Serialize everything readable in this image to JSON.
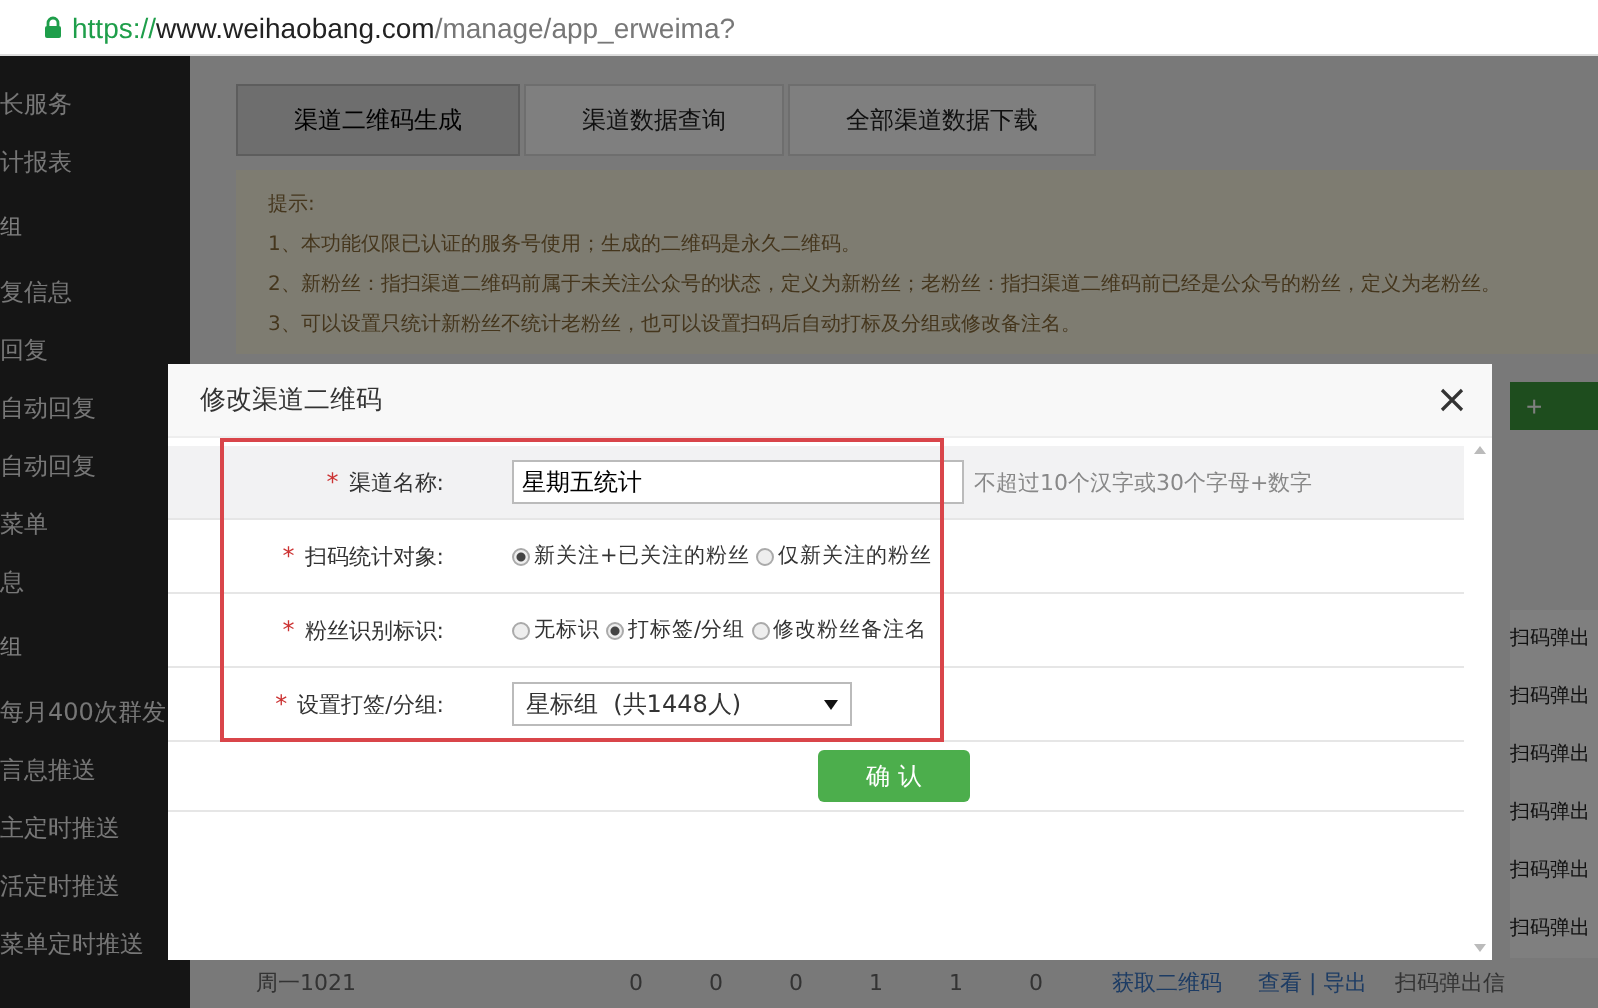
{
  "address_bar": {
    "scheme": "https://",
    "host": "www.weihaobang.com",
    "path": "/manage/app_erweima?"
  },
  "sidebar": {
    "items": [
      {
        "kind": "item",
        "label": "长服务"
      },
      {
        "kind": "item",
        "label": "计报表"
      },
      {
        "kind": "header",
        "label": "组"
      },
      {
        "kind": "item",
        "label": "复信息"
      },
      {
        "kind": "item",
        "label": "回复"
      },
      {
        "kind": "item",
        "label": "自动回复"
      },
      {
        "kind": "item",
        "label": "自动回复"
      },
      {
        "kind": "item",
        "label": "菜单"
      },
      {
        "kind": "item",
        "label": "息"
      },
      {
        "kind": "header",
        "label": "组"
      },
      {
        "kind": "item",
        "label": "每月400次群发"
      },
      {
        "kind": "item",
        "label": "言息推送"
      },
      {
        "kind": "item",
        "label": "主定时推送"
      },
      {
        "kind": "item",
        "label": "活定时推送"
      },
      {
        "kind": "item",
        "label": "菜单定时推送"
      }
    ]
  },
  "tabs": [
    {
      "label": "渠道二维码生成",
      "selected": true
    },
    {
      "label": "渠道数据查询",
      "selected": false
    },
    {
      "label": "全部渠道数据下载",
      "selected": false
    }
  ],
  "notice": {
    "title": "提示:",
    "lines": [
      "1、本功能仅限已认证的服务号使用；生成的二维码是永久二维码。",
      "2、新粉丝：指扫渠道二维码前属于未关注公众号的状态，定义为新粉丝；老粉丝：指扫渠道二维码前已经是公众号的粉丝，定义为老粉丝。",
      "3、可以设置只统计新粉丝不统计老粉丝，也可以设置扫码后自动打标及分组或修改备注名。"
    ]
  },
  "create_button": {
    "label": "+"
  },
  "side_column": {
    "cells": [
      "扫码弹出",
      "扫码弹出",
      "扫码弹出",
      "扫码弹出",
      "扫码弹出",
      "扫码弹出"
    ]
  },
  "table_row": {
    "cells": [
      "周一1021",
      "0",
      "0",
      "0",
      "1",
      "1",
      "0"
    ],
    "links": [
      "获取二维码",
      "查看 | 导出"
    ],
    "last": "扫码弹出信"
  },
  "dialog": {
    "title": "修改渠道二维码",
    "fields": [
      {
        "kind": "text",
        "required_mark": "*",
        "label": "渠道名称:",
        "value": "星期五统计",
        "hint": "不超过10个汉字或30个字母+数字"
      },
      {
        "kind": "radio",
        "required_mark": "*",
        "label": "扫码统计对象:",
        "options": [
          {
            "label": "新关注+已关注的粉丝",
            "selected": true
          },
          {
            "label": "仅新关注的粉丝",
            "selected": false
          }
        ]
      },
      {
        "kind": "radio",
        "required_mark": "*",
        "label": "粉丝识别标识:",
        "options": [
          {
            "label": "无标识",
            "selected": false
          },
          {
            "label": "打标签/分组",
            "selected": true
          },
          {
            "label": "修改粉丝备注名",
            "selected": false
          }
        ]
      },
      {
        "kind": "select",
        "required_mark": "*",
        "label": "设置打签/分组:",
        "value": "星标组  (共1448人)"
      }
    ],
    "confirm_button": "确 认"
  }
}
